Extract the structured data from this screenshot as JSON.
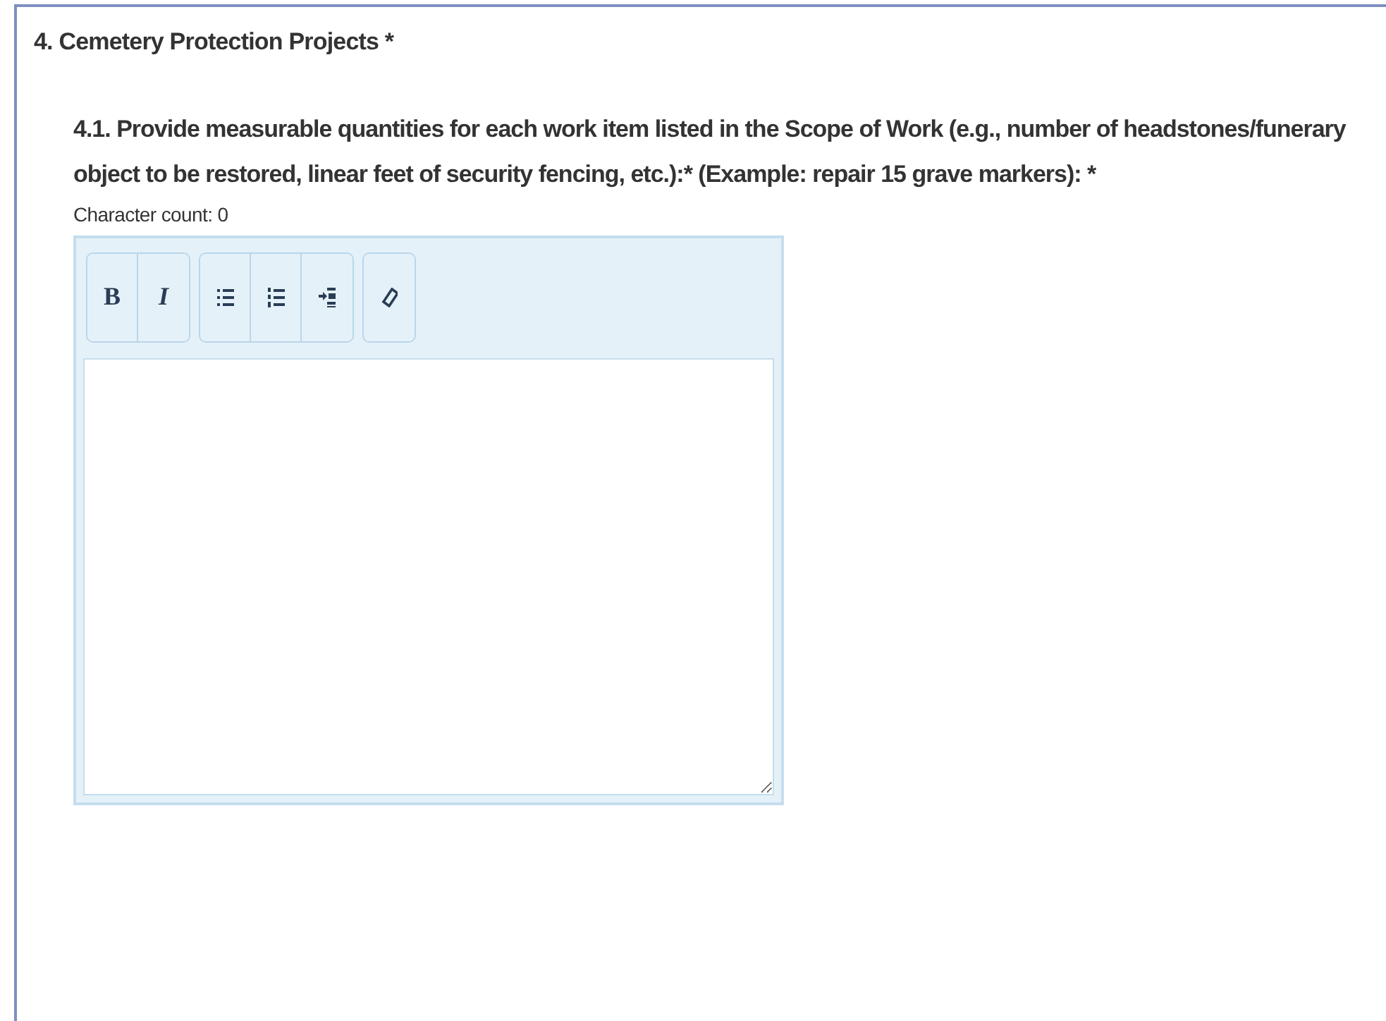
{
  "section": {
    "title": "4. Cemetery Protection Projects *"
  },
  "question": {
    "text": "4.1. Provide measurable quantities for each work item listed in the Scope of Work (e.g., number of headstones/funerary object to be restored, linear feet of security fencing, etc.):* (Example: repair 15 grave markers): *",
    "character_count": "Character count: 0"
  },
  "toolbar": [
    [
      {
        "kind": "bold",
        "label": "B"
      },
      {
        "kind": "italic",
        "label": "I"
      }
    ],
    [
      {
        "kind": "bullet-list"
      },
      {
        "kind": "numbered-list"
      },
      {
        "kind": "indent"
      }
    ],
    [
      {
        "kind": "eraser"
      }
    ]
  ]
}
